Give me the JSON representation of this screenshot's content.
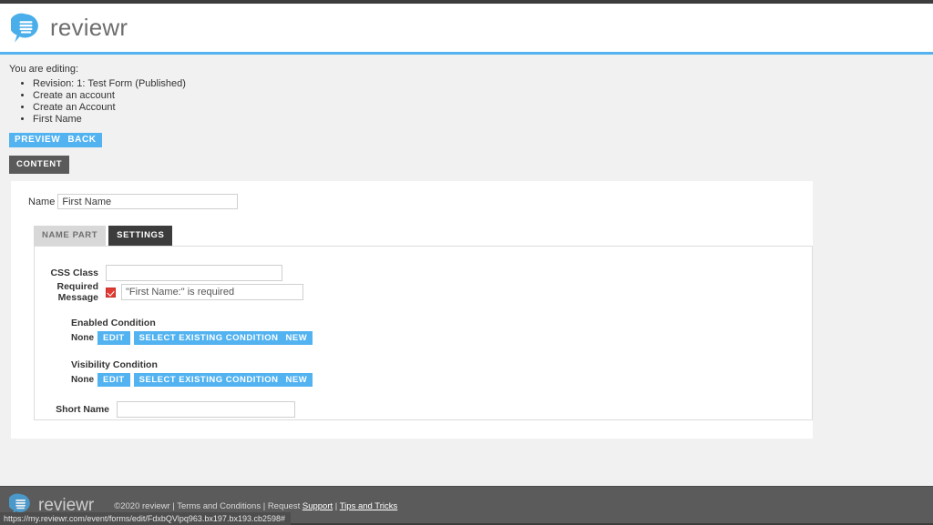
{
  "colors": {
    "accent_blue": "#52b3f0",
    "dark_tab": "#3c3c3c",
    "content_tab": "#5a5a5a",
    "required_checkbox_red": "#e23a33",
    "page_background": "#f1f1f1",
    "footer_background": "#5b5b5b"
  },
  "header": {
    "logo_icon": "speech-bubble-lines-icon",
    "brand": "reviewr"
  },
  "editing": {
    "label": "You are editing:",
    "breadcrumbs": [
      "Revision: 1: Test Form (Published)",
      "Create an account",
      "Create an Account",
      "First Name"
    ]
  },
  "actions": {
    "preview": "PREVIEW",
    "back": "BACK"
  },
  "content_tab": {
    "label": "CONTENT"
  },
  "panel": {
    "name_field": {
      "label": "Name",
      "value": "First Name",
      "placeholder": ""
    },
    "tabs": [
      {
        "label": "NAME PART",
        "active": false
      },
      {
        "label": "SETTINGS",
        "active": true
      }
    ],
    "settings": {
      "css_class": {
        "label": "CSS Class",
        "value": "",
        "placeholder": ""
      },
      "required_message": {
        "label": "Required Message",
        "checked": true,
        "value": "\"First Name:\" is required",
        "placeholder": ""
      },
      "enabled_condition": {
        "title": "Enabled Condition",
        "value": "None",
        "edit_label": "EDIT",
        "select_existing_label": "SELECT EXISTING CONDITION",
        "new_label": "NEW"
      },
      "visibility_condition": {
        "title": "Visibility Condition",
        "value": "None",
        "edit_label": "EDIT",
        "select_existing_label": "SELECT EXISTING CONDITION",
        "new_label": "NEW"
      },
      "short_name": {
        "label": "Short Name",
        "value": "",
        "placeholder": ""
      }
    }
  },
  "footer": {
    "logo_icon": "speech-bubble-lines-icon",
    "brand": "reviewr",
    "copyright": "©2020 reviewr  |  Terms and Conditions  |  Request ",
    "support_link": "Support",
    "separator": "  |  ",
    "tips_link": "Tips and Tricks"
  },
  "status_bar": {
    "url": "https://my.reviewr.com/event/forms/edit/FdxbQVlpq963.bx197.bx193.cb2598#"
  }
}
